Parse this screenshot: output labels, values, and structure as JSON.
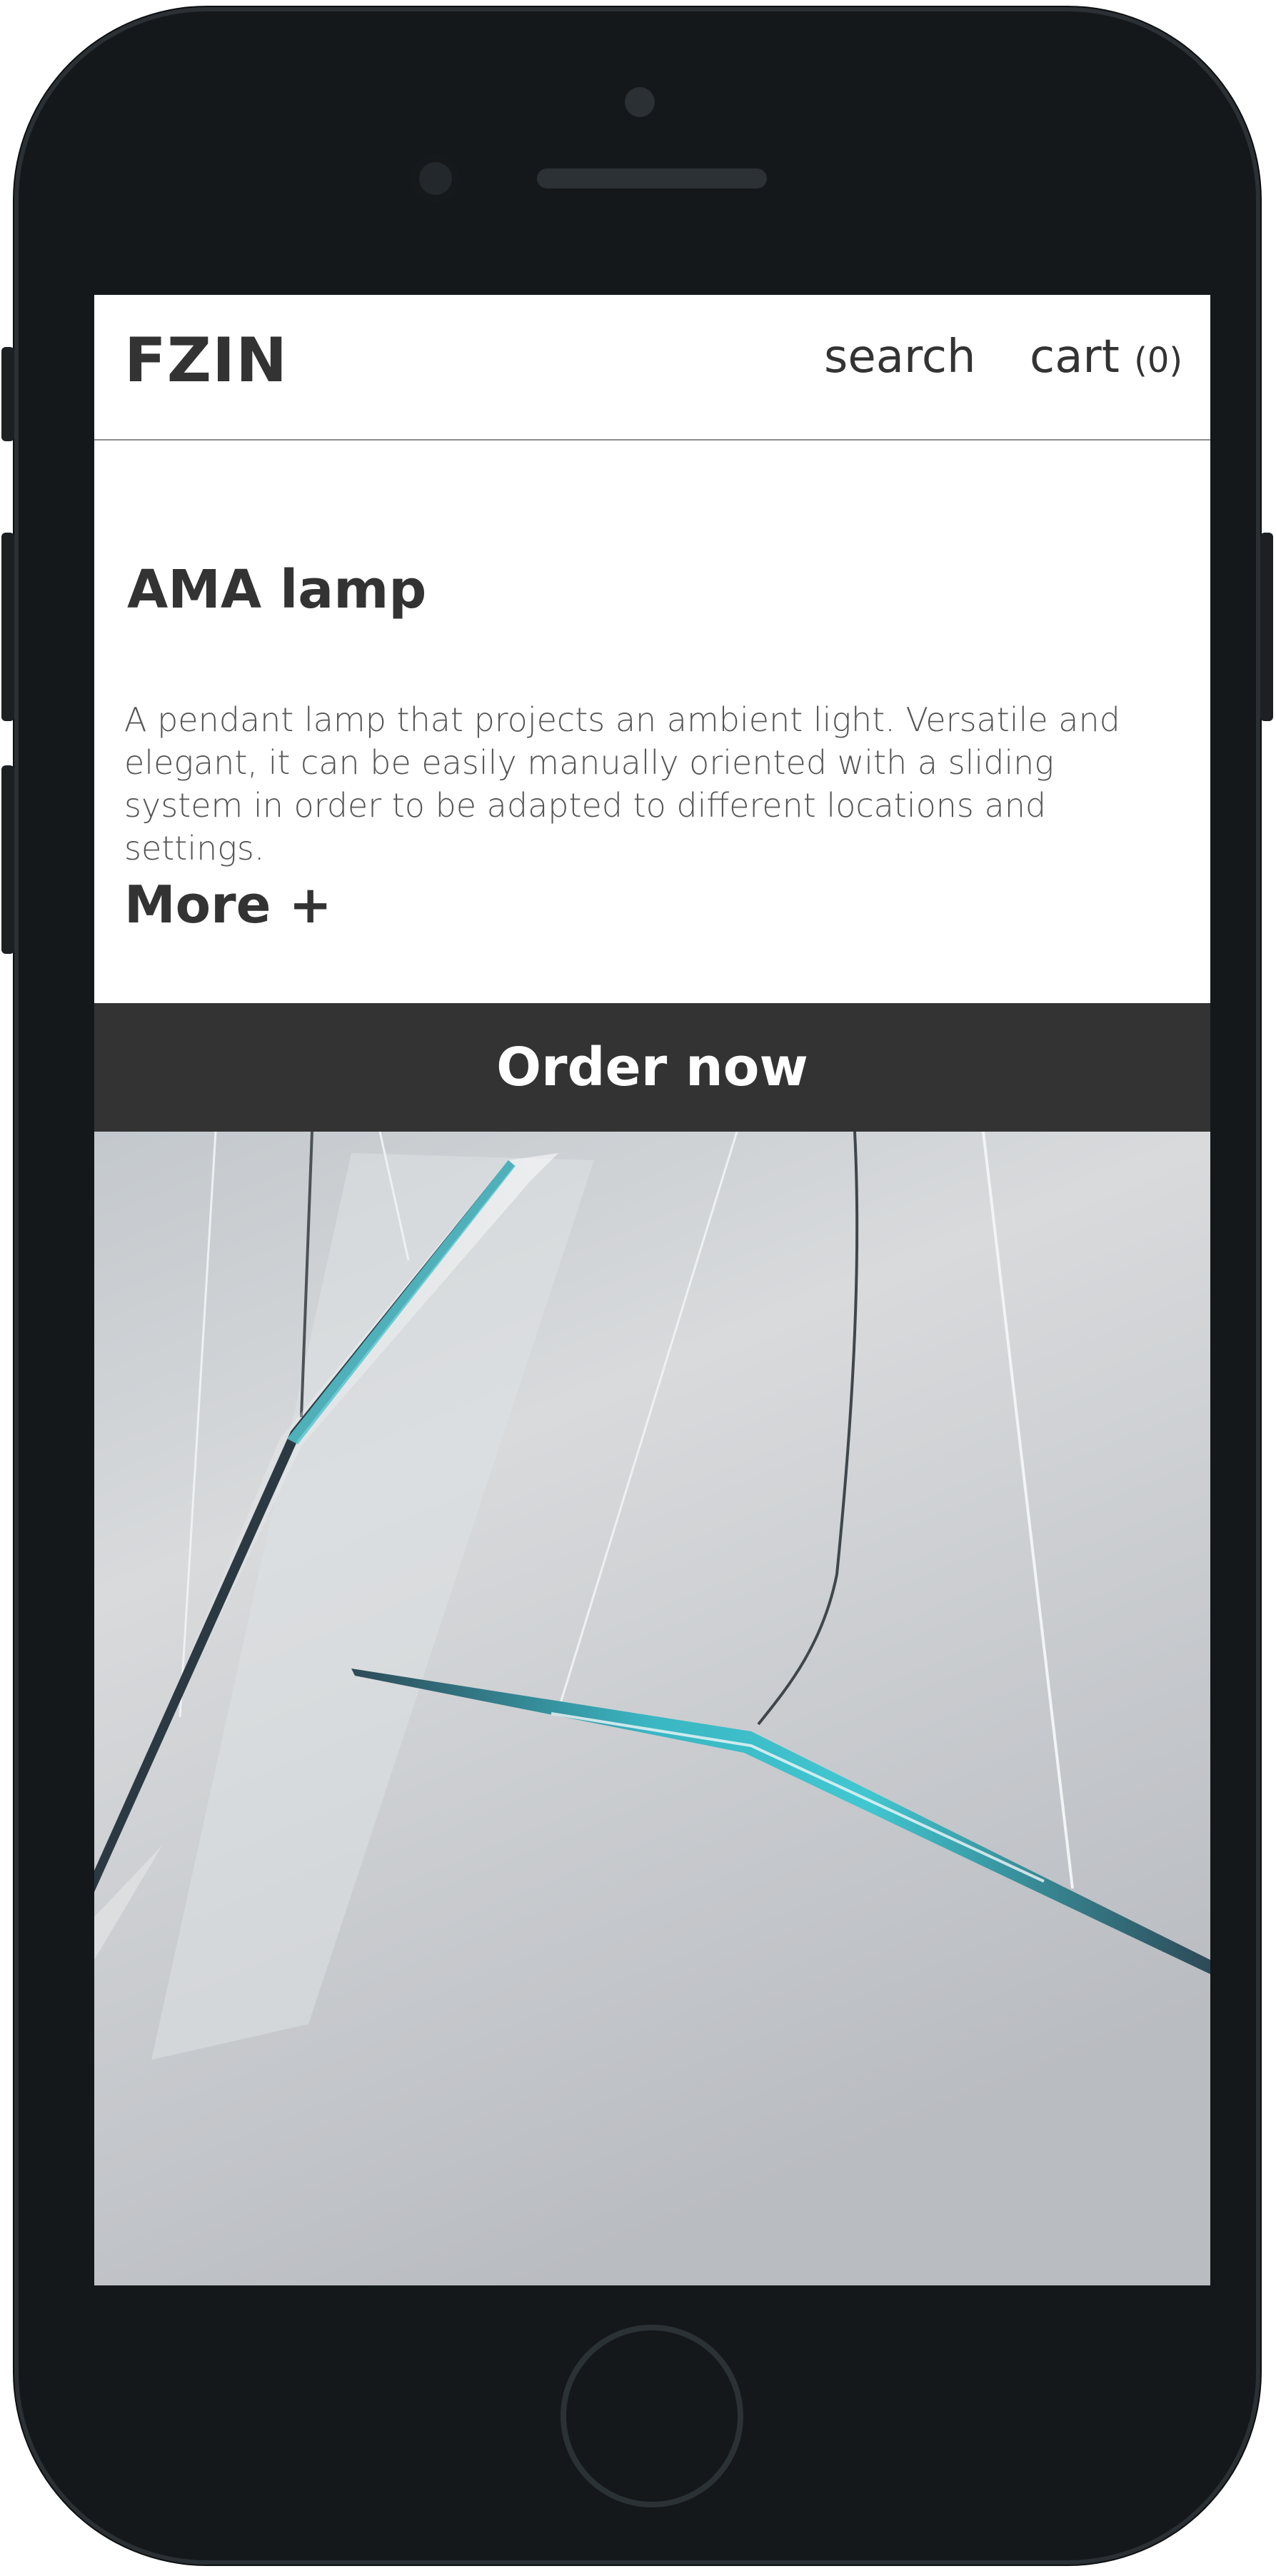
{
  "header": {
    "logo": "FZIN",
    "search_label": "search",
    "cart_label": "cart",
    "cart_count": "(0)"
  },
  "product": {
    "title": "AMA lamp",
    "description": "A pendant lamp that projects an ambient light. Versatile and elegant, it can be easily manually oriented with a sliding system in order to be adapted to different locations and settings.",
    "more_label": "More +",
    "order_label": "Order now"
  },
  "colors": {
    "dark_bar": "#333333",
    "text": "#333333",
    "lamp_accent": "#40c4d0"
  }
}
